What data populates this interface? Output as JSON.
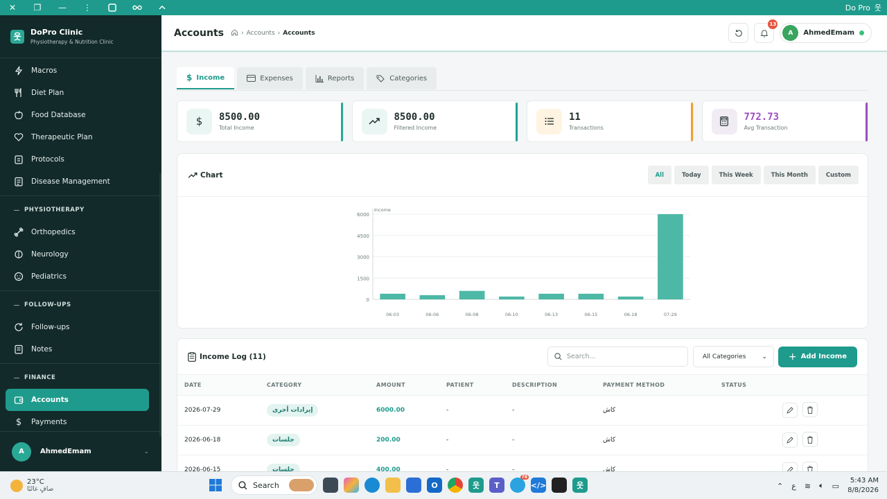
{
  "window": {
    "title": "Do Pro",
    "title_icon": "person-icon"
  },
  "sidebar": {
    "brand_title": "DoPro Clinic",
    "brand_subtitle": "Physiotherapy & Nutrition Clinic",
    "items_top": [
      {
        "label": "Macros",
        "icon": "lightning-icon"
      },
      {
        "label": "Diet Plan",
        "icon": "utensils-icon"
      },
      {
        "label": "Food Database",
        "icon": "apple-icon"
      },
      {
        "label": "Therapeutic Plan",
        "icon": "heart-icon"
      },
      {
        "label": "Protocols",
        "icon": "clipboard-icon"
      },
      {
        "label": "Disease Management",
        "icon": "notes-icon"
      }
    ],
    "section_physio": "PHYSIOTHERAPY",
    "items_physio": [
      {
        "label": "Orthopedics",
        "icon": "bone-icon"
      },
      {
        "label": "Neurology",
        "icon": "brain-icon"
      },
      {
        "label": "Pediatrics",
        "icon": "child-icon"
      }
    ],
    "section_followups": "FOLLOW-UPS",
    "items_followups": [
      {
        "label": "Follow-ups",
        "icon": "refresh-icon"
      },
      {
        "label": "Notes",
        "icon": "notes-icon"
      }
    ],
    "section_finance": "FINANCE",
    "items_finance": [
      {
        "label": "Accounts",
        "icon": "wallet-icon",
        "active": true
      },
      {
        "label": "Payments",
        "icon": "dollar-icon"
      }
    ],
    "user_initial": "A",
    "user_name": "AhmedEmam"
  },
  "header": {
    "title": "Accounts",
    "breadcrumb": [
      "Accounts",
      "Accounts"
    ],
    "notification_count": "13",
    "profile_initial": "A",
    "profile_name": "AhmedEmam"
  },
  "tabs": [
    {
      "label": "Income",
      "icon": "dollar-icon",
      "active": true
    },
    {
      "label": "Expenses",
      "icon": "card-icon"
    },
    {
      "label": "Reports",
      "icon": "bar-chart-icon"
    },
    {
      "label": "Categories",
      "icon": "tags-icon"
    }
  ],
  "stats": [
    {
      "value": "8500.00",
      "label": "Total Income",
      "icon": "dollar-icon",
      "accent": "#2aa896",
      "icon_bg": "#eaf6f3"
    },
    {
      "value": "8500.00",
      "label": "Filtered Income",
      "icon": "trend-up-icon",
      "accent": "#1fa39b",
      "icon_bg": "#eaf6f3"
    },
    {
      "value": "11",
      "label": "Transactions",
      "icon": "list-icon",
      "accent": "#f0a22c",
      "icon_bg": "#fff3e2"
    },
    {
      "value": "772.73",
      "label": "Avg Transaction",
      "icon": "calculator-icon",
      "accent": "#9b4fc1",
      "icon_bg": "#f1ecf4",
      "value_color": "#9b4fc1"
    }
  ],
  "chart_card": {
    "title": "Chart",
    "filters": [
      "All",
      "Today",
      "This Week",
      "This Month",
      "Custom"
    ],
    "active_filter": "All"
  },
  "chart_data": {
    "type": "bar",
    "legend": "Income",
    "categories": [
      "06-03",
      "06-06",
      "06-08",
      "06-10",
      "06-13",
      "06-15",
      "06-18",
      "07-29"
    ],
    "values": [
      400,
      300,
      600,
      200,
      400,
      400,
      200,
      6000
    ],
    "yticks": [
      0,
      1500,
      3000,
      4500,
      6000
    ],
    "ylim": [
      0,
      6000
    ],
    "color": "#4db8a6"
  },
  "log": {
    "title": "Income Log (11)",
    "search_placeholder": "Search...",
    "category_select": "All Categories",
    "add_button": "Add Income",
    "columns": [
      "DATE",
      "CATEGORY",
      "AMOUNT",
      "PATIENT",
      "DESCRIPTION",
      "PAYMENT METHOD",
      "STATUS"
    ],
    "rows": [
      {
        "date": "2026-07-29",
        "category": "إيرادات أخرى",
        "amount": "6000.00",
        "patient": "-",
        "description": "-",
        "method": "كاش"
      },
      {
        "date": "2026-06-18",
        "category": "جلسات",
        "amount": "200.00",
        "patient": "-",
        "description": "-",
        "method": "كاش"
      },
      {
        "date": "2026-06-15",
        "category": "جلسات",
        "amount": "400.00",
        "patient": "-",
        "description": "-",
        "method": "كاش"
      }
    ]
  },
  "taskbar": {
    "weather_temp": "23°C",
    "weather_desc": "صافٍ غالبًا",
    "search_label": "Search",
    "telegram_badge": "78",
    "lang": "ع",
    "time": "5:43 AM",
    "date": "8/8/2026"
  }
}
